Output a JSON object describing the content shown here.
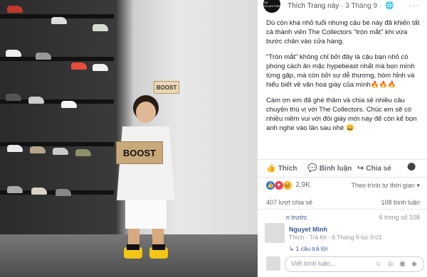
{
  "page": {
    "logo_text": "THE COLLECTORS",
    "header_like": "Thích Trang này",
    "header_sep": "·",
    "header_date": "3 Tháng 9",
    "header_sep2": "·",
    "more": "···"
  },
  "post": {
    "paragraph1": "Dù còn khá nhỏ tuổi nhưng cậu bé này đã khiến tất cả thành viên The Collectors \"tròn mắt\" khi vừa bước chân vào cửa hàng.",
    "paragraph2": "\"Tròn mắt\" không chỉ bởi đây là cậu bạn nhỏ có phong cách ăn mặc hypebeast nhất mà bọn mình từng gặp, mà còn bởi sự dễ thương, hóm hỉnh và hiểu biết về văn hoá giày của mình🔥🔥🔥",
    "paragraph3": "Cám ơn em đã ghé thăm và chia sẻ nhiều câu chuyện thú vị với The Collectors. Chúc em sẽ có nhiều niềm vui với đôi giày mới này để còn kể bọn anh nghe vào lần sau nhé 😄"
  },
  "photo": {
    "box_text": "BOOST",
    "sign_text": "BOOST"
  },
  "actions": {
    "like": "Thích",
    "comment": "Bình luận",
    "share": "Chia sẻ"
  },
  "stats": {
    "reactions_count": "2,9K",
    "sort_label": "Theo trình tự thời gian",
    "shares": "407 lượt chia sẻ",
    "comments_count": "108 bình luận"
  },
  "comments": {
    "previous_label": "n trước",
    "previous_count": "6 trong số 108",
    "author": "Nguyet Minh",
    "meta": "Thích · Trả lời · 6 Tháng 9 lúc 0:01",
    "replies": "1 câu trả lời",
    "write_placeholder": "Viết bình luận...",
    "write_icons": "☺ ◎ ▣ ◉"
  },
  "colors": {
    "link": "#385898",
    "secondary": "#606770",
    "like_blue": "#1877f2",
    "love_red": "#f33e58",
    "haha_yellow": "#f7b125"
  }
}
